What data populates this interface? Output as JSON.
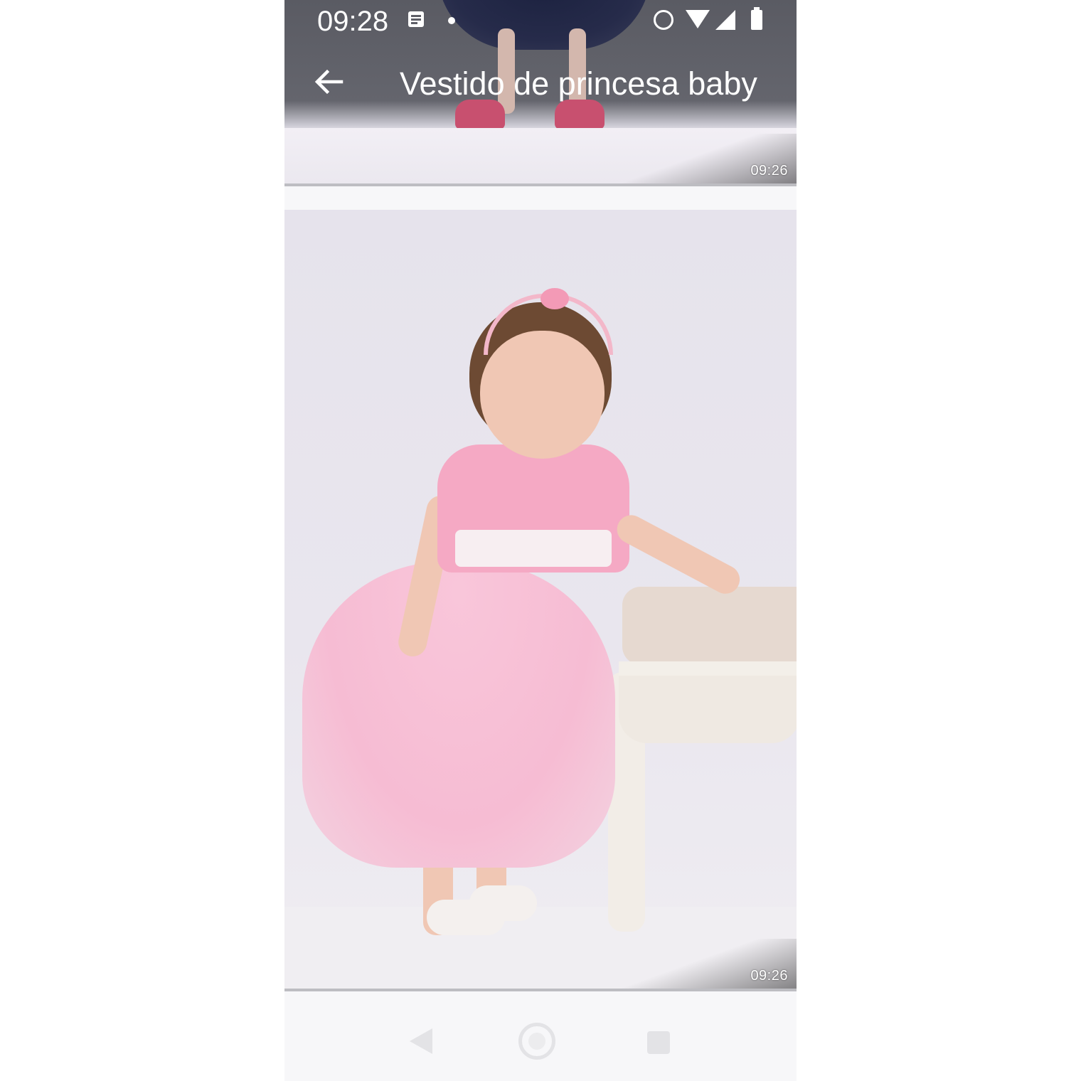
{
  "status_bar": {
    "time": "09:28",
    "icons": [
      "message-icon",
      "notification-dot",
      "alarm-icon",
      "wifi-icon",
      "signal-icon",
      "battery-icon"
    ]
  },
  "app_bar": {
    "title": "Vestido de princesa baby",
    "back_icon": "arrow-left-icon"
  },
  "media": [
    {
      "timestamp": "09:26"
    },
    {
      "timestamp": "09:26"
    }
  ],
  "nav_bar": {
    "icons": [
      "nav-back-icon",
      "nav-home-icon",
      "nav-recents-icon"
    ]
  },
  "colors": {
    "app_bar_overlay": "#5d5e66",
    "background": "#f7f7f9",
    "nav_icon": "#e3e3e6"
  }
}
